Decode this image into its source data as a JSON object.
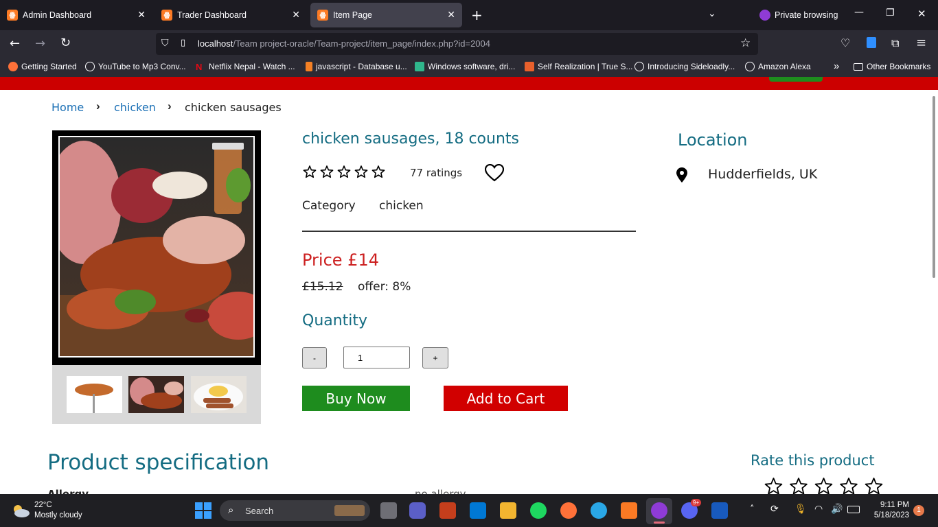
{
  "browser": {
    "tabs": [
      {
        "label": "Admin Dashboard"
      },
      {
        "label": "Trader Dashboard"
      },
      {
        "label": "Item Page"
      }
    ],
    "private_label": "Private browsing",
    "url_host": "localhost",
    "url_path": "/Team project-oracle/Team-project/item_page/index.php?id=2004",
    "bookmarks": [
      {
        "label": "Getting Started"
      },
      {
        "label": "YouTube to Mp3 Conv..."
      },
      {
        "label": "Netflix Nepal - Watch ..."
      },
      {
        "label": "javascript - Database u..."
      },
      {
        "label": "Windows software, dri..."
      },
      {
        "label": "Self Realization | True S..."
      },
      {
        "label": "Introducing Sideloadly..."
      },
      {
        "label": "Amazon Alexa"
      }
    ],
    "other_bookmarks": "Other Bookmarks"
  },
  "breadcrumb": {
    "home": "Home",
    "category": "chicken",
    "current": "chicken sausages"
  },
  "product": {
    "title": "chicken sausages, 18 counts",
    "ratings_text": "77 ratings",
    "rating_value": 0,
    "category_label": "Category",
    "category_value": "chicken",
    "price_text": "Price £14",
    "old_price": "£15.12",
    "offer_text": "offer: 8%",
    "quantity_label": "Quantity",
    "quantity_value": "1",
    "minus_label": "-",
    "plus_label": "+",
    "buy_now_label": "Buy Now",
    "add_to_cart_label": "Add to Cart"
  },
  "location": {
    "heading": "Location",
    "value": "Hudderfields, UK"
  },
  "spec": {
    "heading": "Product specification",
    "partial_left": "Allergy",
    "partial_right": "no allergy"
  },
  "rate": {
    "heading": "Rate this product"
  },
  "taskbar": {
    "weather_temp": "22°C",
    "weather_desc": "Mostly cloudy",
    "search_label": "Search",
    "time": "9:11 PM",
    "date": "5/18/2023",
    "notif_count": "1",
    "discord_badge": "9+"
  },
  "colors": {
    "teal": "#146c82",
    "red": "#cc0000",
    "green": "#1e8c1e",
    "link": "#1a6fb5"
  }
}
